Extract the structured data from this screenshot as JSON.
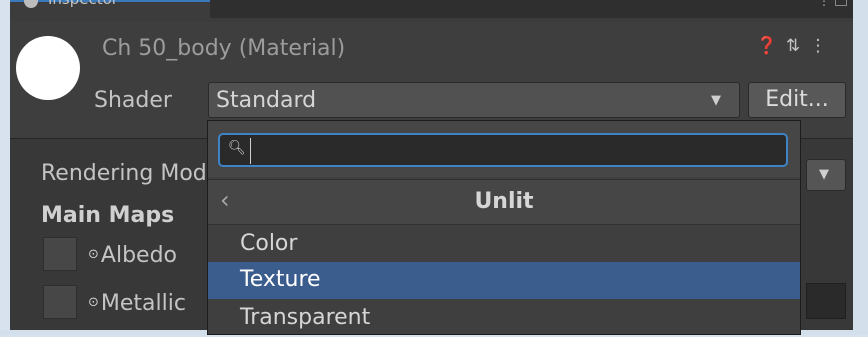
{
  "tab": {
    "title": "Inspector"
  },
  "header": {
    "material_title": "Ch 50_body (Material)",
    "shader_label": "Shader",
    "shader_value": "Standard",
    "edit_label": "Edit...",
    "icons": [
      "help-icon",
      "preset-icon",
      "more-icon"
    ]
  },
  "properties": {
    "rendering_mode_label": "Rendering Mode",
    "main_maps_label": "Main Maps",
    "albedo_label": "Albedo",
    "metallic_label": "Metallic"
  },
  "popup": {
    "search_placeholder": "",
    "search_value": "",
    "category_title": "Unlit",
    "items": [
      {
        "label": "Color",
        "selected": false
      },
      {
        "label": "Texture",
        "selected": true
      },
      {
        "label": "Transparent",
        "selected": false
      }
    ]
  },
  "colors": {
    "selection": "#3b5d8e",
    "focus_border": "#3d84c6",
    "panel": "#3c3c3c"
  }
}
